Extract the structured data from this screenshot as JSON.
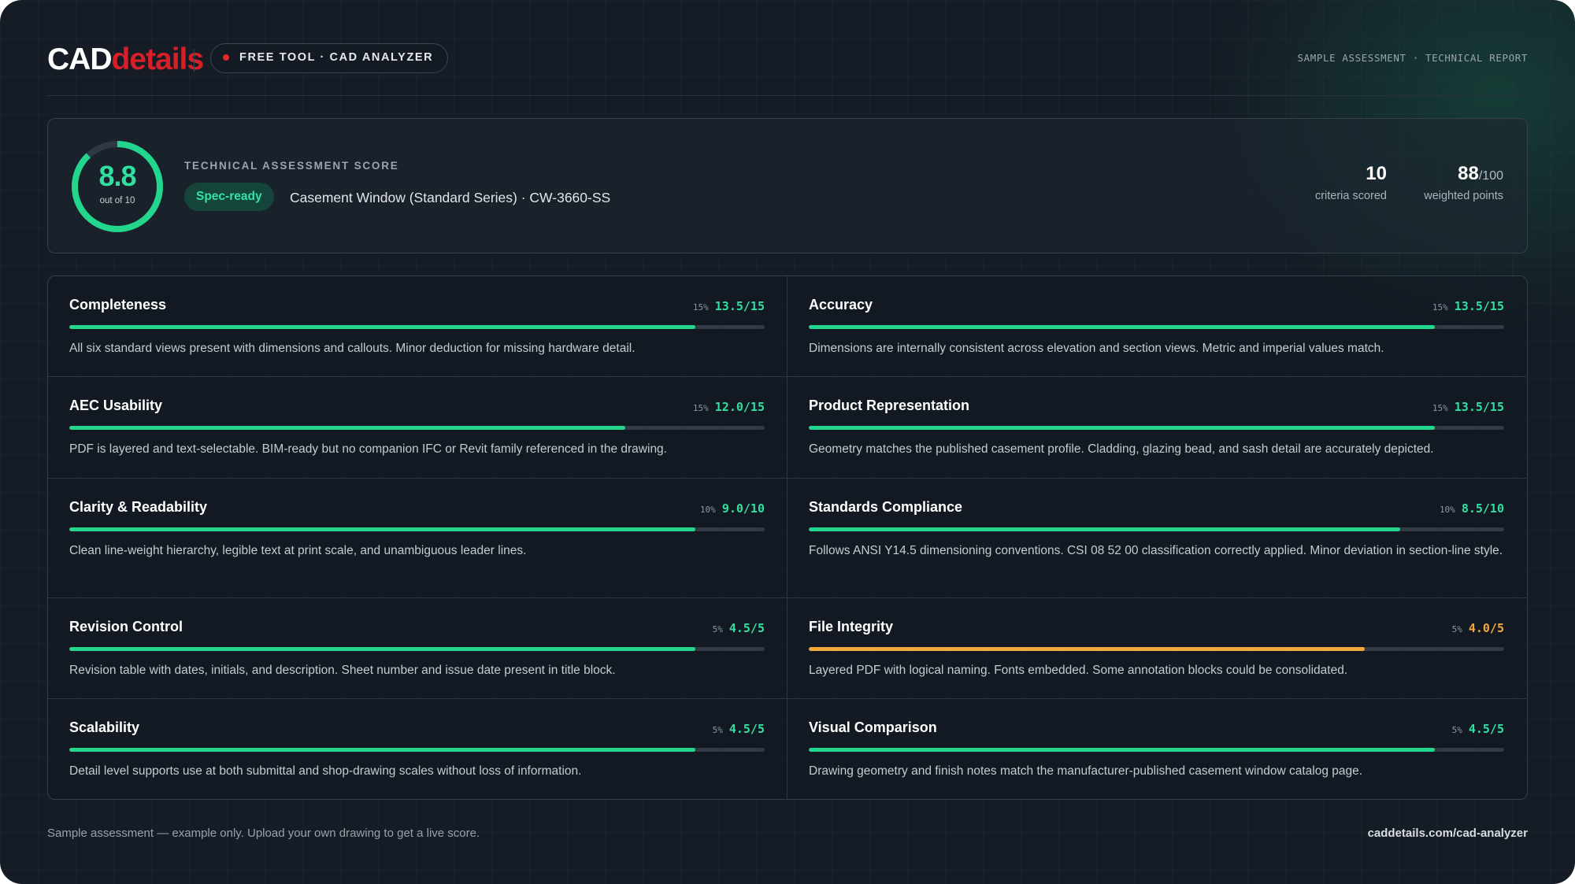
{
  "header": {
    "logo_part1": "CAD",
    "logo_part2": "details",
    "tool_label": "FREE TOOL · CAD ANALYZER",
    "report_label": "SAMPLE ASSESSMENT · TECHNICAL REPORT"
  },
  "score": {
    "value": "8.8",
    "out_of": "out of 10",
    "fraction": 0.88,
    "assessment_label": "TECHNICAL ASSESSMENT SCORE",
    "badge": "Spec-ready",
    "product": "Casement Window (Standard Series) · CW-3660-SS",
    "criteria_count": "10",
    "criteria_label": "criteria scored",
    "points": "88",
    "points_max": "/100",
    "points_label": "weighted points"
  },
  "colors": {
    "accent": "#22d68d",
    "score_green": "#2fe0a0",
    "warning": "#f2a93a",
    "brand_red": "#d61f26"
  },
  "criteria": [
    {
      "title": "Completeness",
      "weight": "15%",
      "score": "13.5/15",
      "fraction": 0.9,
      "status": "good",
      "desc": "All six standard views present with dimensions and callouts. Minor deduction for missing hardware detail."
    },
    {
      "title": "Accuracy",
      "weight": "15%",
      "score": "13.5/15",
      "fraction": 0.9,
      "status": "good",
      "desc": "Dimensions are internally consistent across elevation and section views. Metric and imperial values match."
    },
    {
      "title": "AEC Usability",
      "weight": "15%",
      "score": "12.0/15",
      "fraction": 0.8,
      "status": "good",
      "desc": "PDF is layered and text-selectable. BIM-ready but no companion IFC or Revit family referenced in the drawing."
    },
    {
      "title": "Product Representation",
      "weight": "15%",
      "score": "13.5/15",
      "fraction": 0.9,
      "status": "good",
      "desc": "Geometry matches the published casement profile. Cladding, glazing bead, and sash detail are accurately depicted."
    },
    {
      "title": "Clarity & Readability",
      "weight": "10%",
      "score": "9.0/10",
      "fraction": 0.9,
      "status": "good",
      "desc": "Clean line-weight hierarchy, legible text at print scale, and unambiguous leader lines."
    },
    {
      "title": "Standards Compliance",
      "weight": "10%",
      "score": "8.5/10",
      "fraction": 0.85,
      "status": "good",
      "desc": "Follows ANSI Y14.5 dimensioning conventions. CSI 08 52 00 classification correctly applied. Minor deviation in section-line style."
    },
    {
      "title": "Revision Control",
      "weight": "5%",
      "score": "4.5/5",
      "fraction": 0.9,
      "status": "good",
      "desc": "Revision table with dates, initials, and description. Sheet number and issue date present in title block."
    },
    {
      "title": "File Integrity",
      "weight": "5%",
      "score": "4.0/5",
      "fraction": 0.8,
      "status": "warn",
      "desc": "Layered PDF with logical naming. Fonts embedded. Some annotation blocks could be consolidated."
    },
    {
      "title": "Scalability",
      "weight": "5%",
      "score": "4.5/5",
      "fraction": 0.9,
      "status": "good",
      "desc": "Detail level supports use at both submittal and shop-drawing scales without loss of information."
    },
    {
      "title": "Visual Comparison",
      "weight": "5%",
      "score": "4.5/5",
      "fraction": 0.9,
      "status": "good",
      "desc": "Drawing geometry and finish notes match the manufacturer-published casement window catalog page."
    }
  ],
  "footer": {
    "disclaimer": "Sample assessment — example only. Upload your own drawing to get a live score.",
    "link": "caddetails.com/cad-analyzer"
  }
}
